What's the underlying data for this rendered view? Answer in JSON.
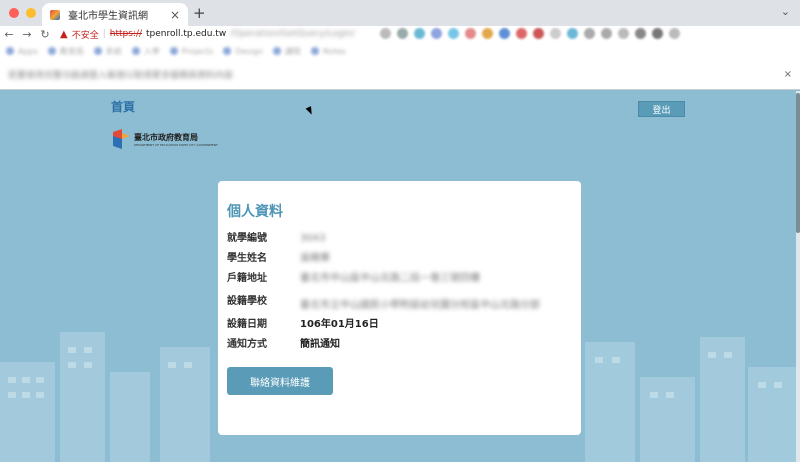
{
  "browser": {
    "tab_title": "臺北市學生資訊網",
    "close_glyph": "×",
    "newtab_glyph": "+",
    "tabmenu_glyph": "⌄",
    "not_secure_label": "不安全",
    "url_scheme": "https://",
    "url_host": "tpenroll.tp.edu.tw",
    "url_rest": "/Operation/GetQuery/Login/",
    "icons": [
      "back-icon",
      "forward-icon",
      "reload-icon",
      "warning-icon"
    ],
    "bookmarks": [
      "Apps",
      "教育局",
      "系統",
      "入學",
      "Projects",
      "Design",
      "課程",
      "Notes"
    ],
    "infobar_text": "若要使用完整功能請登入帳號以取得更多服務與資料內容",
    "infobar_close": "×"
  },
  "header": {
    "home_label": "首頁",
    "logout_label": "登出",
    "logo_name": "臺北市政府教育局",
    "logo_sub": "DEPARTMENT OF EDUCATION TAIPEI CITY GOVERNMENT"
  },
  "card": {
    "title": "個人資料",
    "rows": [
      {
        "key": "就學編號",
        "value": "3043"
      },
      {
        "key": "學生姓名",
        "value": "吳曉華"
      },
      {
        "key": "戶籍地址",
        "value": "臺北市中山區中山北路二段一巷三號四樓"
      },
      {
        "key": "設籍學校",
        "value": "臺北市立中山國民小學附設幼兒園分校區中山北路分部"
      },
      {
        "key": "設籍日期",
        "value": "106年01月16日"
      },
      {
        "key": "通知方式",
        "value": "簡訊通知"
      }
    ],
    "contact_button": "聯絡資料維護"
  },
  "colors": {
    "page_bg": "#8dbdd3",
    "accent": "#5a9bb8",
    "title_color": "#4e96b6",
    "home_link": "#2c6fa6"
  }
}
